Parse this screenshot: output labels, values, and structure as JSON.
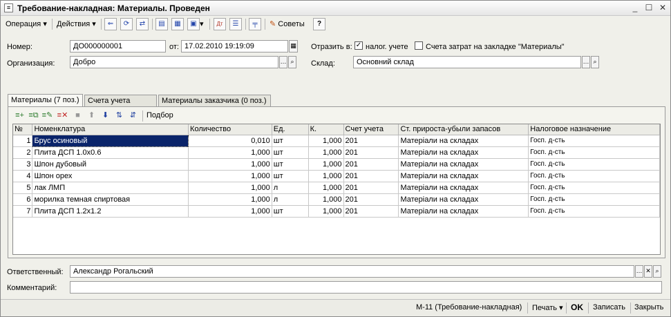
{
  "window": {
    "title": "Требование-накладная: Материалы. Проведен"
  },
  "toolbar": {
    "operation_label": "Операция",
    "actions_label": "Действия",
    "advice_label": "Советы",
    "help_label": "?"
  },
  "form": {
    "number_label": "Номер:",
    "number_value": "ДО000000001",
    "date_label": "от:",
    "date_value": "17.02.2010 19:19:09",
    "reflect_label": "Отразить в:",
    "tax_label": "налог. учете",
    "tax_checked": true,
    "costs_label": "Счета затрат на закладке \"Материалы\"",
    "costs_checked": false,
    "org_label": "Организация:",
    "org_value": "Добро",
    "warehouse_label": "Склад:",
    "warehouse_value": "Основний склад"
  },
  "tabs": [
    {
      "label": "Материалы (7 поз.)",
      "active": true
    },
    {
      "label": "Счета учета затрат",
      "active": false
    },
    {
      "label": "Материалы заказчика (0 поз.)",
      "active": false
    }
  ],
  "panel_toolbar": {
    "pick_label": "Подбор"
  },
  "table": {
    "columns": [
      "№",
      "Номенклатура",
      "Количество",
      "Ед.",
      "К.",
      "Счет учета",
      "Ст. прироста-убыли запасов",
      "Налоговое назначение"
    ],
    "rows": [
      [
        "1",
        "Брус осиновый",
        "0,010",
        "шт",
        "1,000",
        "201",
        "Матеріали на складах",
        "Госп. д-сть"
      ],
      [
        "2",
        "Плита ДСП 1.0х0.6",
        "1,000",
        "шт",
        "1,000",
        "201",
        "Матеріали на складах",
        "Госп. д-сть"
      ],
      [
        "3",
        "Шпон дубовый",
        "1,000",
        "шт",
        "1,000",
        "201",
        "Матеріали на складах",
        "Госп. д-сть"
      ],
      [
        "4",
        "Шпон орех",
        "1,000",
        "шт",
        "1,000",
        "201",
        "Матеріали на складах",
        "Госп. д-сть"
      ],
      [
        "5",
        "лак ЛМП",
        "1,000",
        "л",
        "1,000",
        "201",
        "Матеріали на складах",
        "Госп. д-сть"
      ],
      [
        "6",
        "морилка темная спиртовая",
        "1,000",
        "л",
        "1,000",
        "201",
        "Матеріали на складах",
        "Госп. д-сть"
      ],
      [
        "7",
        "Плита ДСП 1.2х1.2",
        "1,000",
        "шт",
        "1,000",
        "201",
        "Матеріали на складах",
        "Госп. д-сть"
      ]
    ]
  },
  "footer": {
    "responsible_label": "Ответственный:",
    "responsible_value": "Александр Рогальский",
    "comment_label": "Комментарий:",
    "comment_value": ""
  },
  "bottom": {
    "form_label": "М-11 (Требование-накладная)",
    "print_label": "Печать",
    "ok_label": "OK",
    "save_label": "Записать",
    "close_label": "Закрыть"
  }
}
